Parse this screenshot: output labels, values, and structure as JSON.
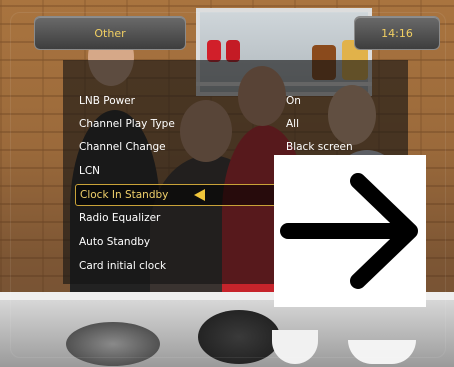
{
  "header": {
    "title": "Other",
    "clock": "14:16"
  },
  "menu": {
    "items": [
      {
        "label": "LNB Power",
        "value": "On"
      },
      {
        "label": "Channel Play Type",
        "value": "All"
      },
      {
        "label": "Channel Change",
        "value": "Black screen"
      },
      {
        "label": "LCN",
        "value": ""
      },
      {
        "label": "Clock In Standby",
        "value": ""
      },
      {
        "label": "Radio Equalizer",
        "value": ""
      },
      {
        "label": "Auto Standby",
        "value": ""
      },
      {
        "label": "Card initial clock",
        "value": ""
      }
    ],
    "selected_index": 4
  },
  "overlay": {
    "icon": "right-arrow-icon"
  },
  "colors": {
    "header_text": "#f1cf63",
    "selection_border": "#c9a238",
    "selection_arrow": "#f1c63a"
  }
}
